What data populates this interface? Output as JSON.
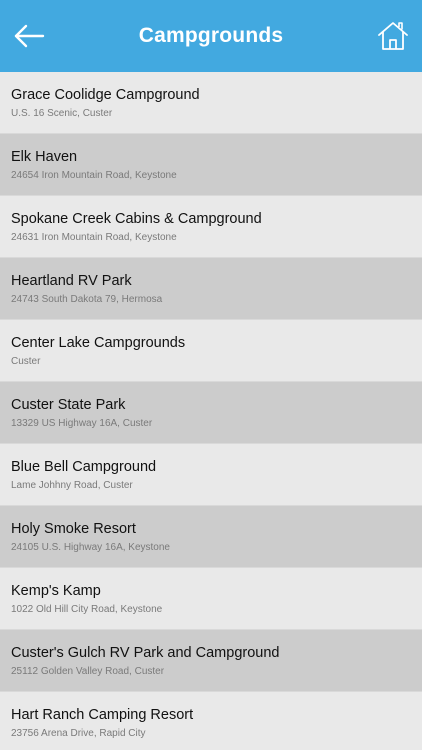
{
  "header": {
    "title": "Campgrounds",
    "back_icon": "arrow-left-icon",
    "home_icon": "home-icon",
    "background_color": "#42a9e0"
  },
  "list": {
    "row_colors": {
      "light": "#e9e9e9",
      "dark": "#cccccc"
    },
    "items": [
      {
        "name": "Grace Coolidge Campground",
        "address": "U.S. 16 Scenic, Custer"
      },
      {
        "name": "Elk Haven",
        "address": "24654 Iron Mountain Road, Keystone"
      },
      {
        "name": "Spokane Creek Cabins & Campground",
        "address": "24631 Iron Mountain Road, Keystone"
      },
      {
        "name": "Heartland RV Park",
        "address": "24743 South Dakota 79, Hermosa"
      },
      {
        "name": "Center Lake Campgrounds",
        "address": "Custer"
      },
      {
        "name": "Custer State Park",
        "address": "13329 US Highway 16A, Custer"
      },
      {
        "name": "Blue Bell Campground",
        "address": "Lame Johhny Road, Custer"
      },
      {
        "name": "Holy Smoke Resort",
        "address": "24105 U.S. Highway 16A, Keystone"
      },
      {
        "name": "Kemp's Kamp",
        "address": "1022 Old Hill City Road, Keystone"
      },
      {
        "name": "Custer's Gulch RV Park and Campground",
        "address": "25112 Golden Valley Road, Custer"
      },
      {
        "name": "Hart Ranch Camping Resort",
        "address": "23756 Arena Drive, Rapid City"
      }
    ]
  }
}
